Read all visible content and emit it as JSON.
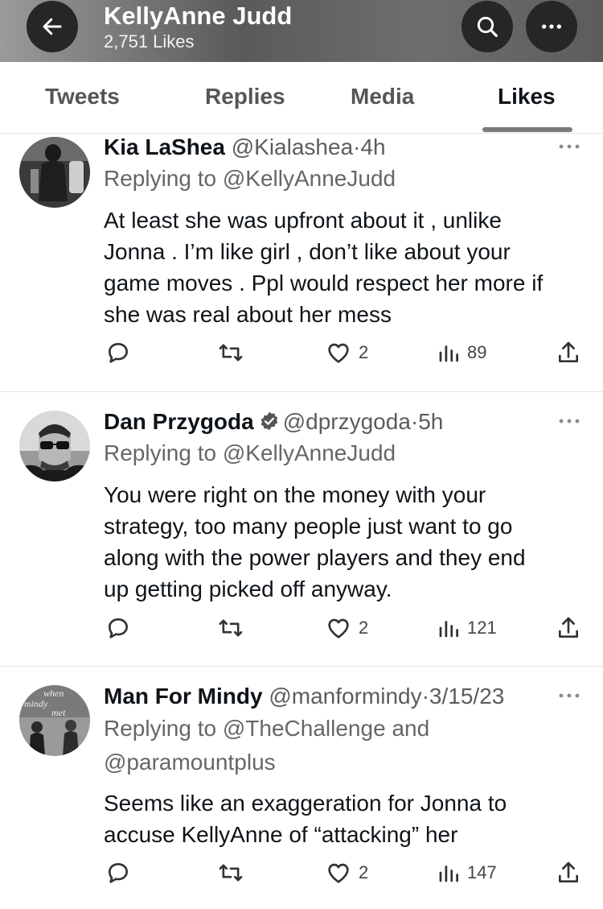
{
  "header": {
    "name": "KellyAnne Judd",
    "subtitle": "2,751 Likes"
  },
  "tabs": [
    {
      "label": "Tweets"
    },
    {
      "label": "Replies"
    },
    {
      "label": "Media"
    },
    {
      "label": "Likes",
      "active": true
    }
  ],
  "tweets": [
    {
      "name": "Kia LaShea",
      "handle": "@Kialashea",
      "time": "4h",
      "verified": false,
      "reply_prefix": "Replying to",
      "reply_to": "@KellyAnneJudd",
      "text_lines": [
        "At least she was upfront about it , unlike",
        "Jonna . I’m like girl , don’t like about your",
        "game moves . Ppl would respect her more if",
        "she was real about her mess"
      ],
      "likes": "2",
      "views": "89"
    },
    {
      "name": "Dan Przygoda",
      "handle": "@dprzygoda",
      "time": "5h",
      "verified": true,
      "reply_prefix": "Replying to",
      "reply_to": "@KellyAnneJudd",
      "text_lines": [
        "You were right on the money with your",
        "strategy, too many people just want to go",
        "along with the power players and they end",
        "up getting picked off anyway."
      ],
      "likes": "2",
      "views": "121"
    },
    {
      "name": "Man For Mindy",
      "handle": "@manformindy",
      "time": "3/15/23",
      "verified": false,
      "reply_prefix": "Replying to",
      "reply_to": "@TheChallenge",
      "reply_and": "and",
      "reply_to2": "@paramountplus",
      "avatar_text": [
        "when",
        "mindy",
        "met"
      ],
      "text_lines": [
        "Seems like an exaggeration for Jonna to",
        "accuse KellyAnne of “attacking” her"
      ],
      "likes": "2",
      "views": "147"
    }
  ],
  "icons": {
    "back": "arrow-left-icon",
    "search": "search-icon",
    "more": "more-dots-icon",
    "reply": "reply-icon",
    "retweet": "retweet-icon",
    "like": "heart-icon",
    "views": "views-icon",
    "share": "share-icon",
    "verified": "verified-badge-icon"
  },
  "colors": {
    "text": "#0f1419",
    "secondary": "#5c5c5c",
    "header_button": "#262626"
  }
}
